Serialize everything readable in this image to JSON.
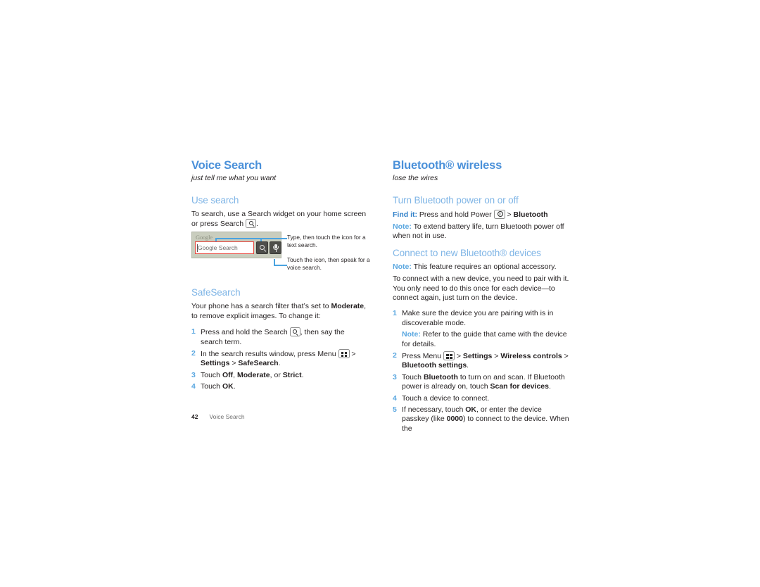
{
  "page": {
    "number": "42",
    "footer_label": "Voice Search"
  },
  "left_column": {
    "chapter_title": "Voice Search",
    "chapter_subtitle": "just tell me what you want",
    "use_search": {
      "heading": "Use search",
      "paragraph_before_key": "To search, use a Search widget on your home screen or press Search",
      "paragraph_after_key": "."
    },
    "figure": {
      "widget_brand": "Google",
      "widget_input_placeholder": "Google Search",
      "search_button_icon": "magnifier-icon",
      "mic_button_icon": "microphone-icon",
      "callout_top": "Type, then touch the icon for a text search.",
      "callout_bottom": "Touch the icon, then speak for a voice search."
    },
    "safesearch": {
      "heading": "SafeSearch",
      "intro_part1": "Your phone has a search filter that’s set to ",
      "intro_bold": "Moderate",
      "intro_part2": ", to remove explicit images. To change it:",
      "steps": [
        {
          "num": "1",
          "before_key": "Press and hold the Search ",
          "key_icon": "search-key-icon",
          "after_key": ", then say the search term."
        },
        {
          "num": "2",
          "before_key": "In the search results window, press Menu ",
          "key_icon": "menu-key-icon",
          "after_key": " > ",
          "bold_a": "Settings",
          "sep": " > ",
          "bold_b": "SafeSearch",
          "tail": "."
        },
        {
          "num": "3",
          "text_start": "Touch ",
          "bold_a": "Off",
          "mid_a": ", ",
          "bold_b": "Moderate",
          "mid_b": ", or ",
          "bold_c": "Strict",
          "tail": "."
        },
        {
          "num": "4",
          "text_start": "Touch ",
          "bold_a": "OK",
          "tail": "."
        }
      ]
    }
  },
  "right_column": {
    "chapter_title": "Bluetooth® wireless",
    "chapter_subtitle": "lose the wires",
    "power_section": {
      "heading": "Turn Bluetooth power on or off",
      "find_it_label": "Find it:",
      "find_it_before_key": " Press and hold Power ",
      "power_key_icon": "power-key-icon",
      "find_it_sep": " > ",
      "find_it_bold": "Bluetooth",
      "note_label": "Note:",
      "note_text": " To extend battery life, turn Bluetooth power off when not in use."
    },
    "connect_section": {
      "heading": "Connect to new Bluetooth® devices",
      "note_label": "Note:",
      "note_text": " This feature requires an optional accessory.",
      "paragraph": "To connect with a new device, you need to pair with it. You only need to do this once for each device—to connect again, just turn on the device.",
      "steps": [
        {
          "num": "1",
          "text": "Make sure the device you are pairing with is in discoverable mode.",
          "note_label": "Note:",
          "note_text": " Refer to the guide that came with the device for details."
        },
        {
          "num": "2",
          "before_key": "Press Menu ",
          "key_icon": "menu-key-icon",
          "after_key": " > ",
          "bold_a": "Settings",
          "sep_a": " > ",
          "bold_b": "Wireless controls",
          "sep_b": " > ",
          "bold_c": "Bluetooth settings",
          "tail": "."
        },
        {
          "num": "3",
          "text_start": "Touch ",
          "bold_a": "Bluetooth",
          "mid_a": " to turn on and scan. If Bluetooth power is already on, touch ",
          "bold_b": "Scan for devices",
          "tail": "."
        },
        {
          "num": "4",
          "text": "Touch a device to connect."
        },
        {
          "num": "5",
          "text_start": "If necessary, touch ",
          "bold_a": "OK",
          "mid_a": ", or enter the device passkey (like ",
          "bold_b": "0000",
          "tail": ") to connect to the device. When the"
        }
      ]
    }
  },
  "colors": {
    "chapter_blue": "#4a90d9",
    "section_blue": "#7fb5e6",
    "label_blue": "#2f7fc8",
    "note_blue": "#5aa7e0",
    "leader_blue": "#4aa3e0",
    "highlight_red": "#e8453c",
    "widget_bg": "#c9cdbe"
  }
}
